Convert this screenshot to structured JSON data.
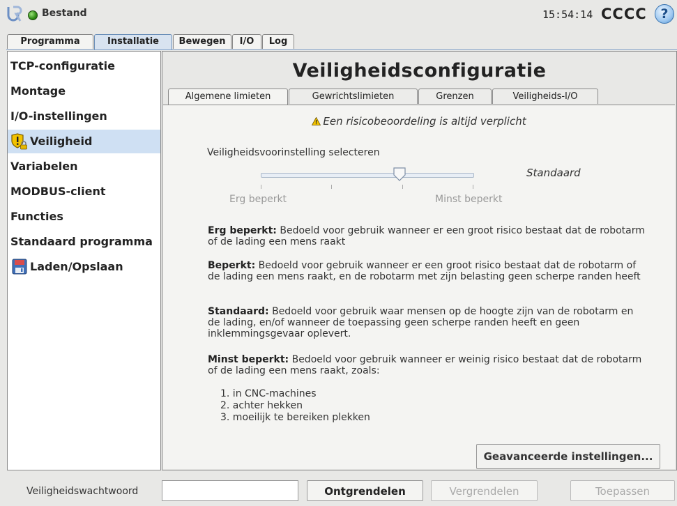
{
  "titlebar": {
    "file_menu": "Bestand",
    "clock": "15:54:14",
    "robot_name": "CCCC",
    "help_label": "?"
  },
  "main_tabs": [
    {
      "label": "Programma",
      "active": false
    },
    {
      "label": "Installatie",
      "active": true
    },
    {
      "label": "Bewegen",
      "active": false
    },
    {
      "label": "I/O",
      "active": false
    },
    {
      "label": "Log",
      "active": false
    }
  ],
  "sidebar": {
    "items": [
      {
        "label": "TCP-configuratie"
      },
      {
        "label": "Montage"
      },
      {
        "label": "I/O-instellingen"
      },
      {
        "label": "Veiligheid",
        "icon": "shield-lock-icon",
        "selected": true
      },
      {
        "label": "Variabelen"
      },
      {
        "label": "MODBUS-client"
      },
      {
        "label": "Functies"
      },
      {
        "label": "Standaard programma"
      },
      {
        "label": "Laden/Opslaan",
        "icon": "floppy-disk-icon"
      }
    ]
  },
  "main": {
    "title": "Veiligheidsconfiguratie",
    "tabs": [
      {
        "label": "Algemene limieten",
        "active": true
      },
      {
        "label": "Gewrichtslimieten",
        "active": false
      },
      {
        "label": "Grenzen",
        "active": false
      },
      {
        "label": "Veiligheids-I/O",
        "active": false
      }
    ],
    "warning": "Een risicobeoordeling is altijd verplicht",
    "preset": {
      "label": "Veiligheidsvoorinstelling selecteren",
      "value": "Standaard",
      "min_label": "Erg beperkt",
      "max_label": "Minst beperkt",
      "level": 3,
      "levels": 4
    },
    "descriptions": [
      {
        "term": "Erg beperkt:",
        "text": " Bedoeld voor gebruik wanneer er een groot risico bestaat dat de robotarm of de lading een mens raakt"
      },
      {
        "term": "Beperkt:",
        "text": " Bedoeld voor gebruik wanneer er een groot risico bestaat dat de robotarm of de lading een mens raakt, en de robotarm met zijn belasting geen scherpe randen heeft"
      },
      {
        "term": "Standaard:",
        "text": " Bedoeld voor gebruik waar mensen op de hoogte zijn van de robotarm en de lading, en/of wanneer de toepassing geen scherpe randen heeft en geen inklemmingsgevaar oplevert."
      },
      {
        "term": "Minst beperkt:",
        "text": " Bedoeld voor gebruik wanneer er weinig risico bestaat dat de robotarm of de lading een mens raakt, zoals:"
      }
    ],
    "list": [
      "1. in CNC-machines",
      "2. achter hekken",
      "3. moeilijk te bereiken plekken"
    ],
    "advanced_button": "Geavanceerde instellingen..."
  },
  "footer": {
    "password_label": "Veiligheidswachtwoord",
    "password_value": "",
    "unlock_button": "Ontgrendelen",
    "lock_button": "Vergrendelen",
    "apply_button": "Toepassen"
  },
  "colors": {
    "selected_bg": "#cfe0f3",
    "status_green": "#2e8b14",
    "warning_yellow": "#f2c200"
  }
}
